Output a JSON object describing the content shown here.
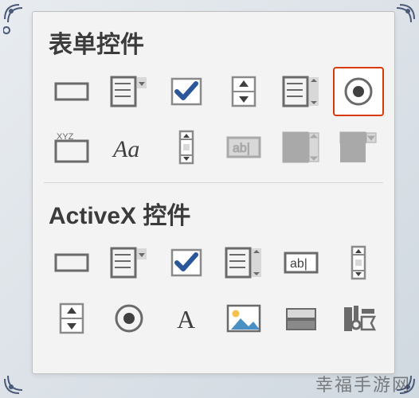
{
  "sections": {
    "form_controls": {
      "title": "表单控件"
    },
    "activex_controls": {
      "title": "ActiveX 控件"
    }
  },
  "watermark": "幸福手游网",
  "icons": {
    "form": [
      {
        "name": "button-icon",
        "label": "button"
      },
      {
        "name": "combobox-icon",
        "label": "combobox"
      },
      {
        "name": "checkbox-icon",
        "label": "checkbox"
      },
      {
        "name": "spin-icon",
        "label": "spin"
      },
      {
        "name": "listbox-icon",
        "label": "listbox"
      },
      {
        "name": "option-icon",
        "label": "option",
        "selected": true
      },
      {
        "name": "groupbox-icon",
        "label": "groupbox",
        "text": "XYZ"
      },
      {
        "name": "label-icon",
        "label": "label",
        "text": "Aa"
      },
      {
        "name": "scrollbar-icon",
        "label": "scrollbar"
      },
      {
        "name": "textfield-icon",
        "label": "textfield",
        "text": "ab|",
        "disabled": true
      },
      {
        "name": "formcombo-icon",
        "label": "formcombo",
        "disabled": true
      },
      {
        "name": "dropdown-icon",
        "label": "dropdown",
        "disabled": true
      }
    ],
    "activex": [
      {
        "name": "ax-button-icon",
        "label": "ax-button"
      },
      {
        "name": "ax-combobox-icon",
        "label": "ax-combobox"
      },
      {
        "name": "ax-checkbox-icon",
        "label": "ax-checkbox"
      },
      {
        "name": "ax-listbox-icon",
        "label": "ax-listbox"
      },
      {
        "name": "ax-textbox-icon",
        "label": "ax-textbox",
        "text": "ab|"
      },
      {
        "name": "ax-scrollbar-icon",
        "label": "ax-scrollbar"
      },
      {
        "name": "ax-spin-icon",
        "label": "ax-spin"
      },
      {
        "name": "ax-option-icon",
        "label": "ax-option"
      },
      {
        "name": "ax-label-icon",
        "label": "ax-label",
        "text": "A"
      },
      {
        "name": "ax-image-icon",
        "label": "ax-image"
      },
      {
        "name": "ax-toggle-icon",
        "label": "ax-toggle"
      },
      {
        "name": "ax-more-icon",
        "label": "ax-more"
      }
    ]
  },
  "colors": {
    "accent_blue": "#2b579a",
    "accent_orange": "#d83b01",
    "grey": "#6a6a6a",
    "light": "#d8d8d8",
    "ax_text": "#404040"
  }
}
